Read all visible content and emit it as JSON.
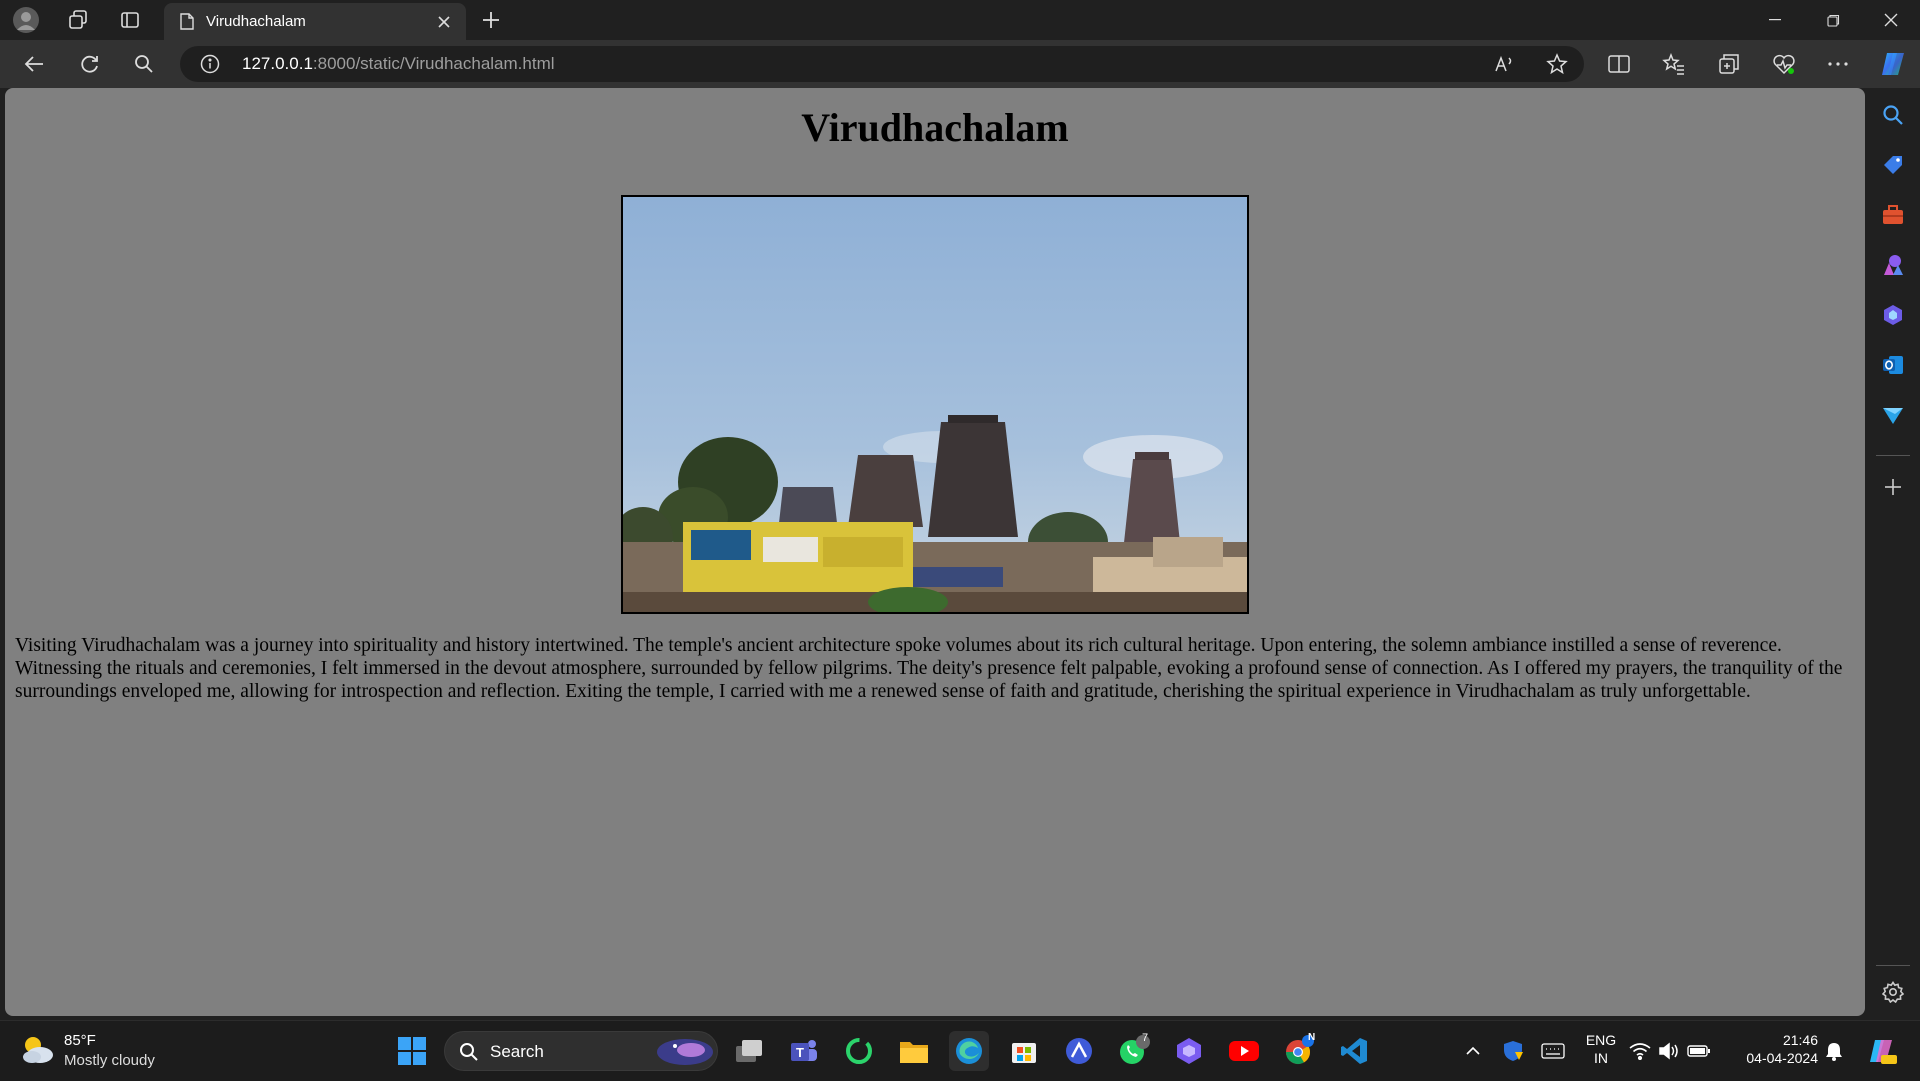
{
  "browser": {
    "tab_title": "Virudhachalam",
    "url_host": "127.0.0.1",
    "url_rest": ":8000/static/Virudhachalam.html"
  },
  "page": {
    "heading": "Virudhachalam",
    "paragraph": "Visiting Virudhachalam was a journey into spirituality and history intertwined. The temple's ancient architecture spoke volumes about its rich cultural heritage. Upon entering, the solemn ambiance instilled a sense of reverence. Witnessing the rituals and ceremonies, I felt immersed in the devout atmosphere, surrounded by fellow pilgrims. The deity's presence felt palpable, evoking a profound sense of connection. As I offered my prayers, the tranquility of the surroundings enveloped me, allowing for introspection and reflection. Exiting the temple, I carried with me a renewed sense of faith and gratitude, cherishing the spiritual experience in Virudhachalam as truly unforgettable."
  },
  "taskbar": {
    "weather_temp": "85°F",
    "weather_condition": "Mostly cloudy",
    "search_label": "Search",
    "whatsapp_badge": "7",
    "chrome_badge": "N",
    "lang_top": "ENG",
    "lang_bottom": "IN",
    "time": "21:46",
    "date": "04-04-2024"
  },
  "colors": {
    "page_background": "#808080",
    "chrome_dark": "#202020",
    "toolbar": "#323232"
  }
}
